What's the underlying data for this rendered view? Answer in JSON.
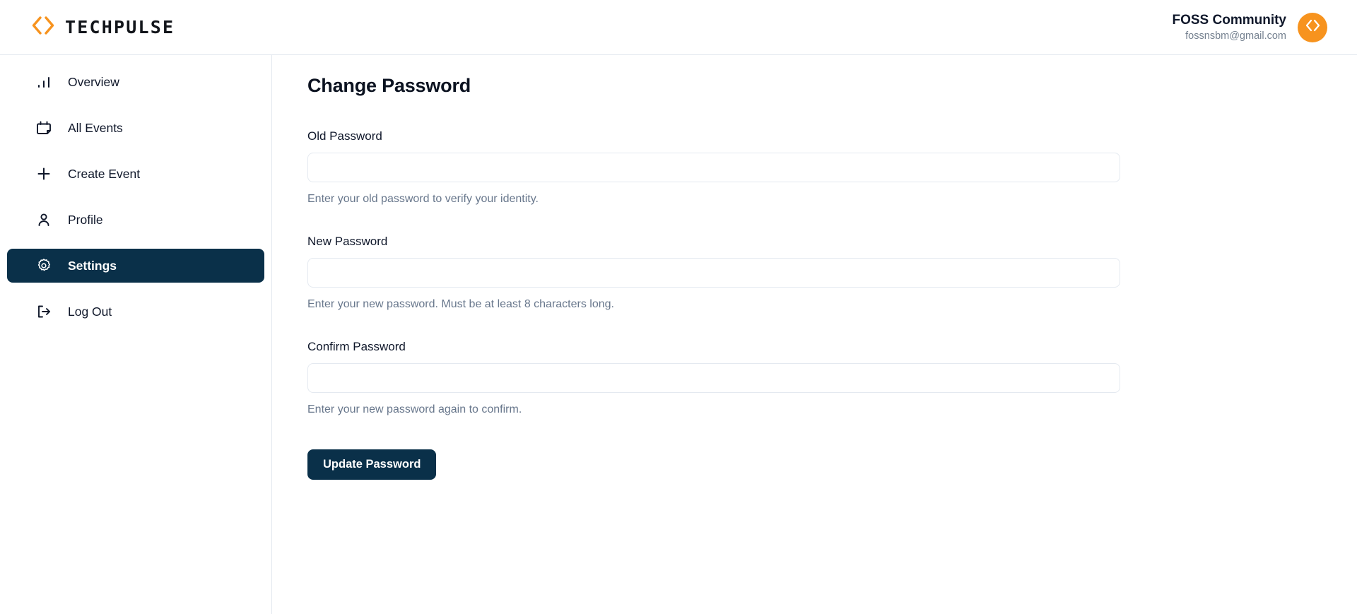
{
  "brand": {
    "name": "TECHPULSE",
    "logo_icon": "code-brackets-icon",
    "accent_color": "#F7931E"
  },
  "header": {
    "user_name": "FOSS Community",
    "user_email": "fossnsbm@gmail.com",
    "avatar_icon": "code-brackets-icon"
  },
  "sidebar": {
    "items": [
      {
        "label": "Overview",
        "icon": "bar-chart-icon",
        "active": false
      },
      {
        "label": "All Events",
        "icon": "calendar-icon",
        "active": false
      },
      {
        "label": "Create Event",
        "icon": "plus-icon",
        "active": false
      },
      {
        "label": "Profile",
        "icon": "user-icon",
        "active": false
      },
      {
        "label": "Settings",
        "icon": "gear-icon",
        "active": true
      },
      {
        "label": "Log Out",
        "icon": "logout-icon",
        "active": false
      }
    ],
    "active_color": "#0a3049"
  },
  "main": {
    "title": "Change Password",
    "fields": [
      {
        "label": "Old Password",
        "value": "",
        "placeholder": "",
        "hint": "Enter your old password to verify your identity."
      },
      {
        "label": "New Password",
        "value": "",
        "placeholder": "",
        "hint": "Enter your new password. Must be at least 8 characters long."
      },
      {
        "label": "Confirm Password",
        "value": "",
        "placeholder": "",
        "hint": "Enter your new password again to confirm."
      }
    ],
    "submit_label": "Update Password"
  }
}
